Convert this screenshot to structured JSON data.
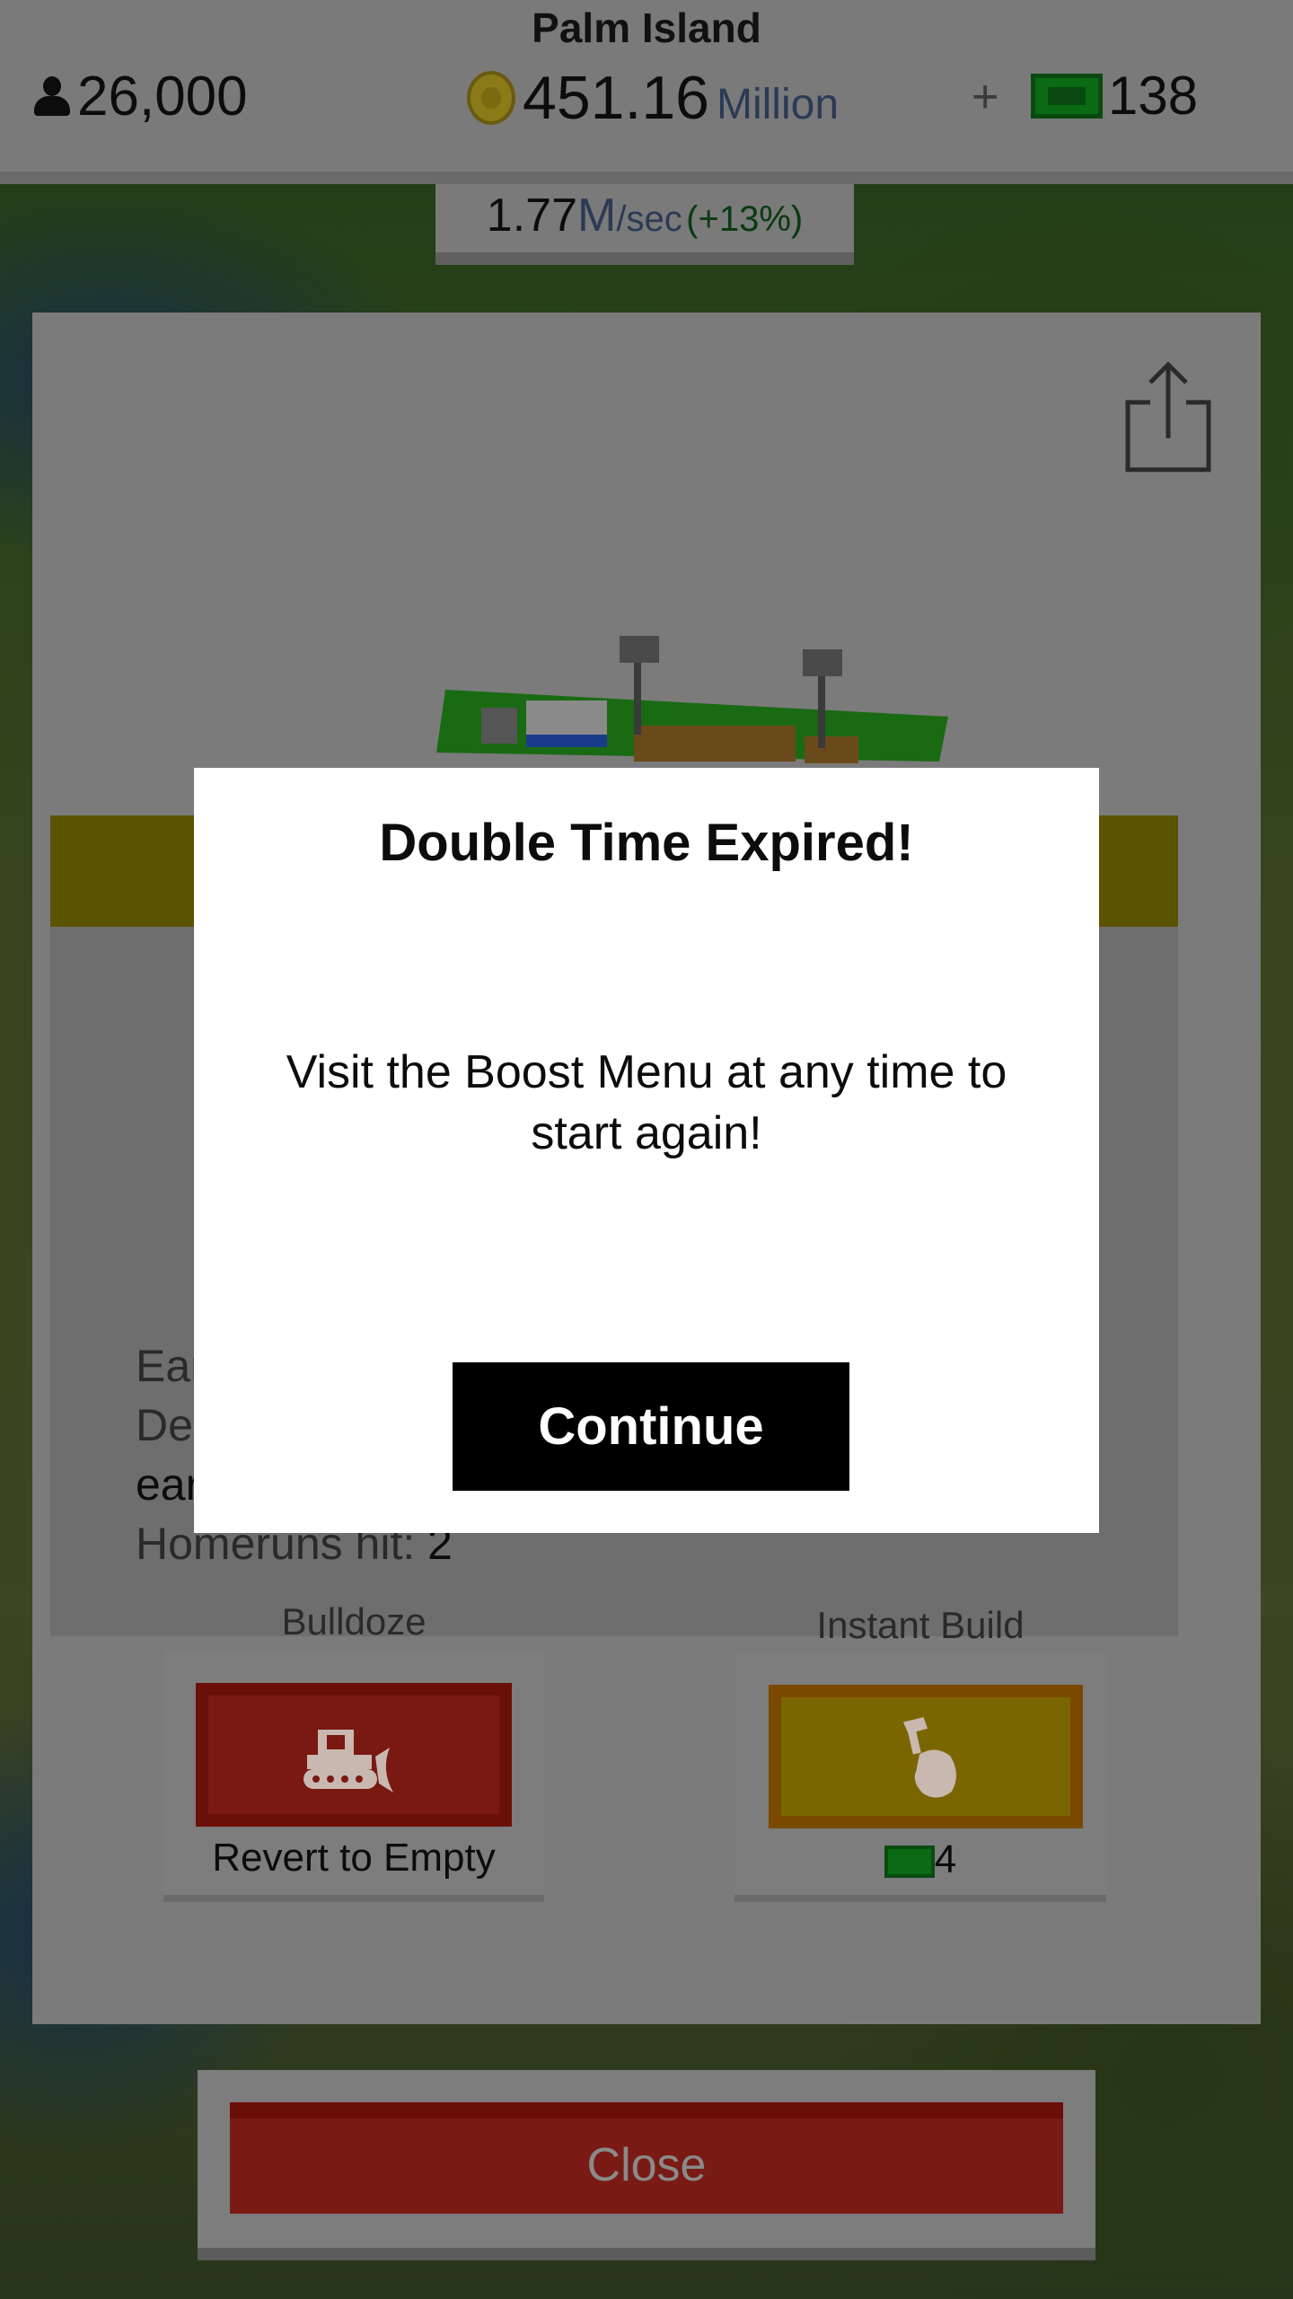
{
  "header": {
    "island_name": "Palm Island",
    "population": "26,000",
    "money_value": "451.16",
    "money_unit": "Million",
    "plus": "+",
    "cash_count": "138"
  },
  "rate": {
    "value": "1.77",
    "unit_main": "M",
    "unit_sec": "/sec",
    "bonus": "(+13%)"
  },
  "info": {
    "line1": "Earn",
    "line2": "Dem",
    "line3": "earn",
    "homeruns_label": "Homeruns hit: ",
    "homeruns_value": "2"
  },
  "tools": {
    "bulldoze_label": "Bulldoze",
    "bulldoze_sub": "Revert to Empty",
    "instant_label": "Instant Build",
    "instant_cost": "4"
  },
  "close_label": "Close",
  "modal": {
    "title": "Double Time Expired!",
    "message": "Visit the Boost Menu at any time to start again!",
    "continue_label": "Continue"
  },
  "colors": {
    "close_red": "#7a1a14",
    "bulldoze_red": "#7a1812",
    "instant_yellow": "#7a6600",
    "cash_green": "#0b6a14"
  },
  "icons": [
    "person-icon",
    "coin-icon",
    "cash-icon",
    "share-icon",
    "bulldozer-icon",
    "hammer-hand-icon"
  ]
}
